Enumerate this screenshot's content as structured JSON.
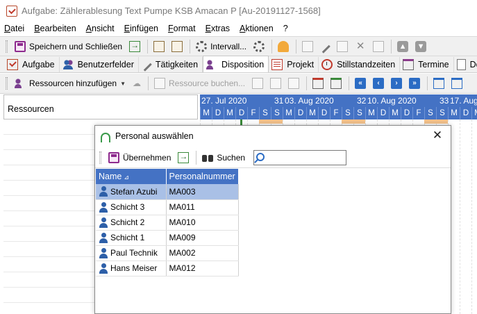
{
  "window": {
    "title": "Aufgabe: Zählerablesung Text Pumpe KSB Amacan P [Au-20191127-1568]"
  },
  "menu": [
    "Datei",
    "Bearbeiten",
    "Ansicht",
    "Einfügen",
    "Format",
    "Extras",
    "Aktionen",
    "?"
  ],
  "toolbar": {
    "save_close": "Speichern und Schließen",
    "interval": "Intervall..."
  },
  "tabs": [
    "Aufgabe",
    "Benutzerfelder",
    "Tätigkeiten",
    "Disposition",
    "Projekt",
    "Stillstandzeiten",
    "Termine",
    "Doku"
  ],
  "active_tab": "Disposition",
  "dispo_toolbar": {
    "add_resources": "Ressourcen hinzufügen",
    "book_resource": "Ressource buchen..."
  },
  "resources_panel": {
    "header": "Ressourcen"
  },
  "gantt": {
    "weeks": [
      {
        "num": "",
        "date": "27. Jul 2020"
      },
      {
        "num": "31",
        "date": "03. Aug 2020"
      },
      {
        "num": "32",
        "date": "10. Aug 2020"
      },
      {
        "num": "33",
        "date": "17. Aug"
      }
    ],
    "days": [
      "M",
      "D",
      "M",
      "D",
      "F",
      "S",
      "S",
      "M",
      "D",
      "M",
      "D",
      "F",
      "S",
      "S",
      "M",
      "D",
      "M",
      "D",
      "F",
      "S",
      "S",
      "M",
      "D",
      "M"
    ]
  },
  "dialog": {
    "title": "Personal auswählen",
    "apply_label": "Übernehmen",
    "search_label": "Suchen",
    "search_value": "",
    "columns": {
      "name": "Name",
      "number": "Personalnummer"
    },
    "rows": [
      {
        "name": "Stefan Azubi",
        "number": "MA003",
        "selected": true
      },
      {
        "name": "Schicht 3",
        "number": "MA011",
        "selected": false
      },
      {
        "name": "Schicht 2",
        "number": "MA010",
        "selected": false
      },
      {
        "name": "Schicht 1",
        "number": "MA009",
        "selected": false
      },
      {
        "name": "Paul Technik",
        "number": "MA002",
        "selected": false
      },
      {
        "name": "Hans Meiser",
        "number": "MA012",
        "selected": false
      }
    ]
  },
  "colors": {
    "header_blue": "#4472c4",
    "selection": "#a9c0e6",
    "weekend": "#f2c08a"
  }
}
